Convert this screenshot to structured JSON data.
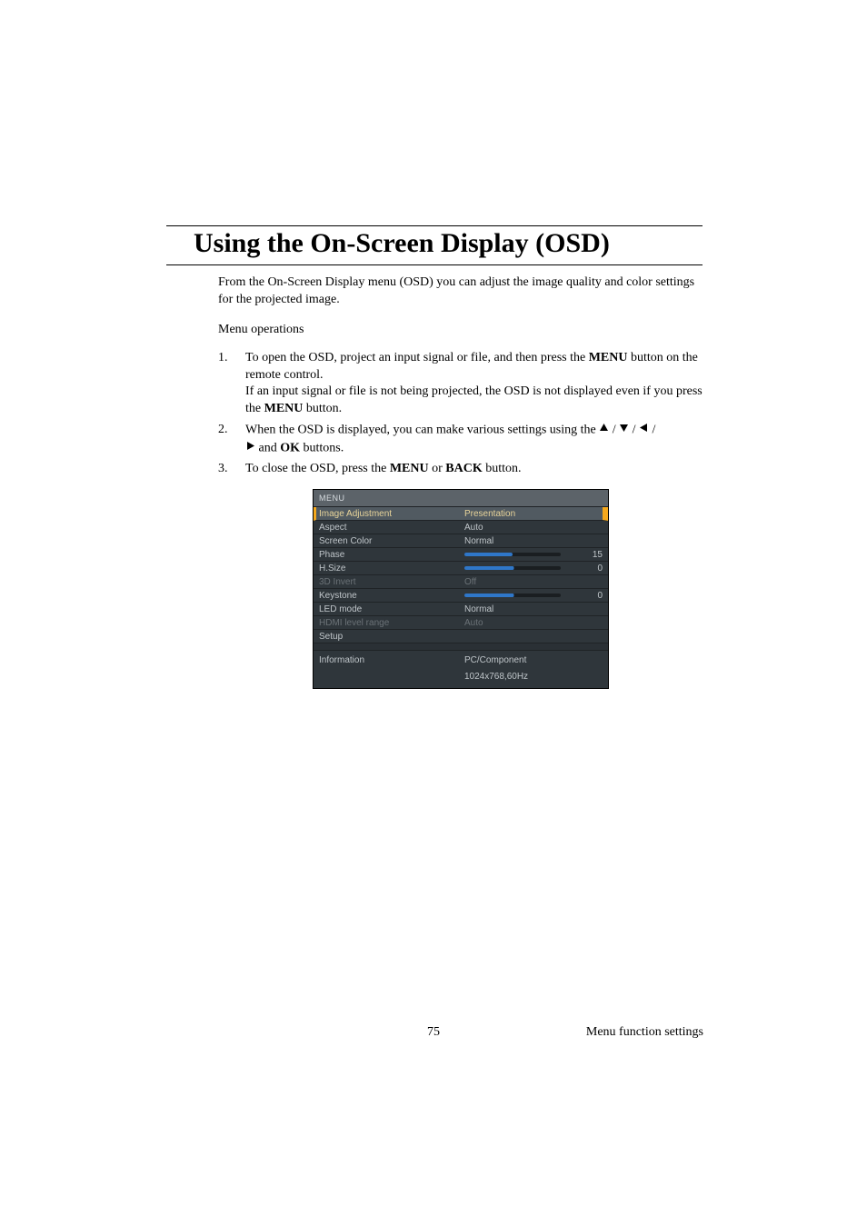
{
  "heading": "Using the On-Screen Display (OSD)",
  "intro": "From the On-Screen Display menu (OSD) you can adjust the image quality and color settings for the projected image.",
  "menu_ops_label": "Menu operations",
  "steps": {
    "s1_num": "1.",
    "s1_a": "To open the OSD, project an input signal or file, and then press the ",
    "s1_menu": "MENU",
    "s1_b": " button on the remote control.",
    "s1_c": "If an input signal or file is not being projected, the OSD is not displayed even if you press the ",
    "s1_menu2": "MENU",
    "s1_d": " button.",
    "s2_num": "2.",
    "s2_a": "When the OSD is displayed, you can make various settings using the ",
    "s2_b": " and ",
    "s2_ok": "OK",
    "s2_c": " buttons.",
    "s3_num": "3.",
    "s3_a": "To close the OSD, press the ",
    "s3_menu": "MENU",
    "s3_b": " or ",
    "s3_back": "BACK",
    "s3_c": " button."
  },
  "osd": {
    "title": "MENU",
    "rows": [
      {
        "label": "Image Adjustment",
        "value": "Presentation",
        "selected": true
      },
      {
        "label": "Aspect",
        "value": "Auto"
      },
      {
        "label": "Screen Color",
        "value": "Normal"
      },
      {
        "label": "Phase",
        "slider": 50,
        "num": "15"
      },
      {
        "label": "H.Size",
        "slider_center": true,
        "num": "0"
      },
      {
        "label": "3D Invert",
        "value": "Off",
        "disabled": true
      },
      {
        "label": "Keystone",
        "slider_center": true,
        "num": "0"
      },
      {
        "label": "LED mode",
        "value": "Normal"
      },
      {
        "label": "HDMI level range",
        "value": "Auto",
        "disabled": true
      },
      {
        "label": "Setup",
        "value": ""
      }
    ],
    "info_label": "Information",
    "info_value1": "PC/Component",
    "info_value2": "1024x768,60Hz"
  },
  "footer": {
    "page": "75",
    "section": "Menu function settings"
  }
}
